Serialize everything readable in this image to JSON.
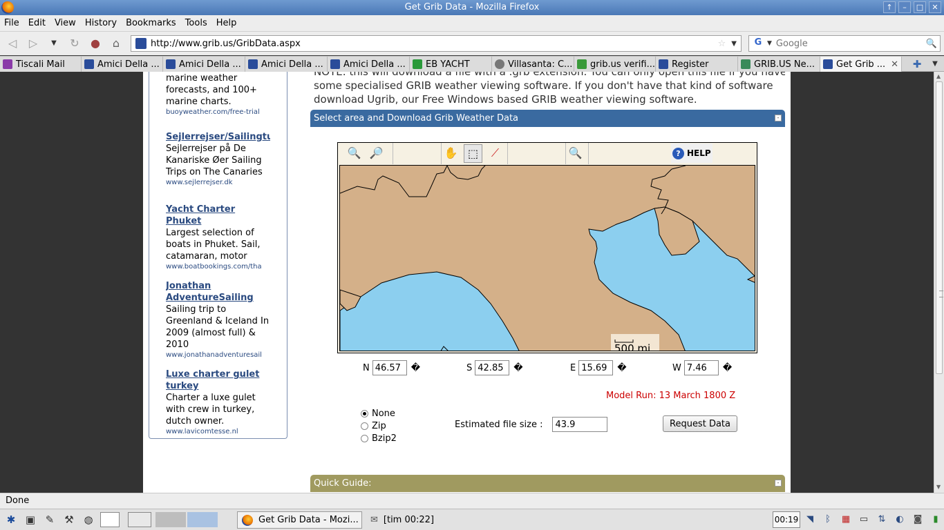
{
  "window": {
    "title": "Get Grib Data - Mozilla Firefox"
  },
  "menu": [
    "File",
    "Edit",
    "View",
    "History",
    "Bookmarks",
    "Tools",
    "Help"
  ],
  "nav": {
    "url": "http://www.grib.us/GribData.aspx",
    "search_placeholder": "Google"
  },
  "tabs": [
    {
      "label": "Tiscali Mail",
      "color": "#8a3aa8"
    },
    {
      "label": "Amici Della ...",
      "color": "#2a4c9a"
    },
    {
      "label": "Amici Della ...",
      "color": "#2a4c9a"
    },
    {
      "label": "Amici Della ...",
      "color": "#2a4c9a"
    },
    {
      "label": "Amici Della ...",
      "color": "#2a4c9a"
    },
    {
      "label": "EB YACHT",
      "color": "#2a9a3a"
    },
    {
      "label": "Villasanta: C...",
      "color": "#777777"
    },
    {
      "label": "grib.us verifi...",
      "color": "#3a9a3a"
    },
    {
      "label": "Register",
      "color": "#2a4c9a"
    },
    {
      "label": "GRIB.US Ne...",
      "color": "#3a8a5a"
    },
    {
      "label": "Get Grib ...",
      "color": "#2a4c9a"
    }
  ],
  "ads": [
    {
      "title": "",
      "desc": "marine weather forecasts, and 100+ marine charts.",
      "url": "buoyweather.com/free-trial"
    },
    {
      "title": "Sejlerrejser/Sailingtu",
      "desc": "Sejlerrejser på De Kanariske Øer Sailing Trips on The Canaries",
      "url": "www.sejlerrejser.dk"
    },
    {
      "title": "Yacht Charter Phuket",
      "desc": "Largest selection of boats in Phuket. Sail, catamaran, motor",
      "url": "www.boatbookings.com/tha"
    },
    {
      "title": "Jonathan AdventureSailing",
      "desc": "Sailing trip to Greenland & Iceland In 2009 (almost full) & 2010",
      "url": "www.jonathanadventuresail"
    },
    {
      "title": "Luxe charter gulet turkey",
      "desc": "Charter a luxe gulet with crew in turkey, dutch owner.",
      "url": "www.lavicomtesse.nl"
    }
  ],
  "notice": {
    "line1": "NOTE: this will download a file with a .grb extension. You can only open this file if you have",
    "line2": "some specialised GRIB weather viewing software. If you don't have that kind of software",
    "line3": "download Ugrib, our Free Windows based GRIB weather viewing software."
  },
  "section": {
    "title": "Select area and Download Grib Weather Data",
    "min": "-"
  },
  "map": {
    "help": "HELP",
    "scale": "500 mi",
    "land_color": "#d4b089",
    "sea_color": "#8ccfef"
  },
  "coords": {
    "n_label": "N",
    "n_value": "46.57",
    "s_label": "S",
    "s_value": "42.85",
    "e_label": "E",
    "e_value": "15.69",
    "w_label": "W",
    "w_value": "7.46",
    "symbol": "�"
  },
  "model_run": "Model Run: 13 March 1800 Z",
  "compression": {
    "none": "None",
    "zip": "Zip",
    "bzip2": "Bzip2"
  },
  "filesize": {
    "label": "Estimated file size :",
    "value": "43.9"
  },
  "request_button": "Request Data",
  "guide": {
    "title": "Quick Guide:",
    "min": "-"
  },
  "status": "Done",
  "taskbar": {
    "firefox": "Get Grib Data - Mozi...",
    "info": "[tim 00:22]",
    "clock": "00:19"
  }
}
